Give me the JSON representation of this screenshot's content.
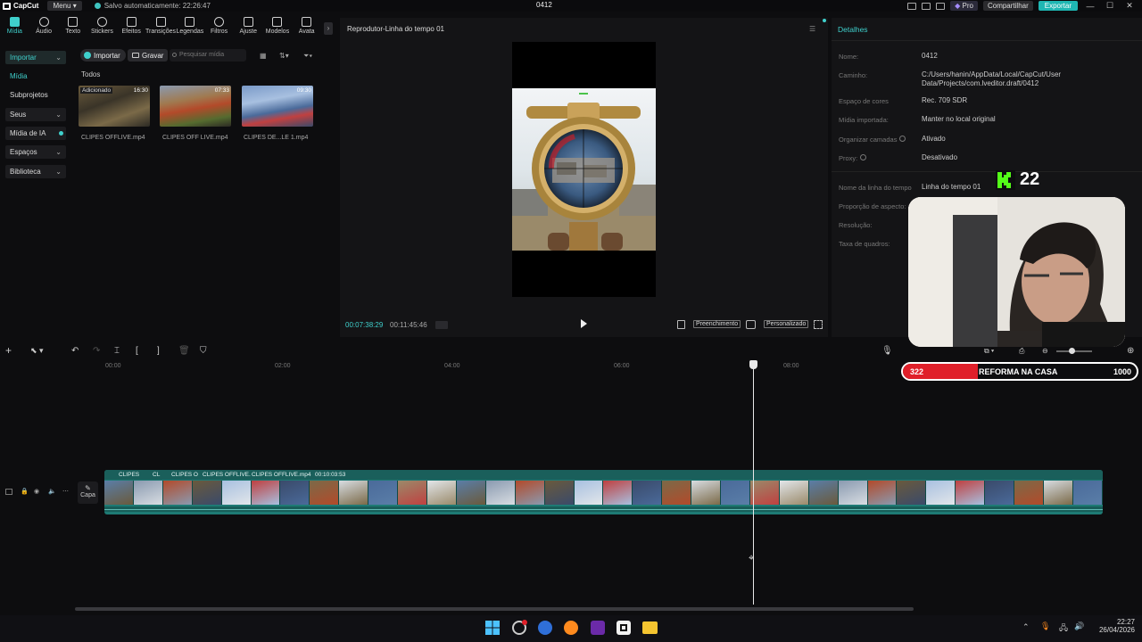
{
  "topbar": {
    "app_name": "CapCut",
    "menu_label": "Menu",
    "autosave": "Salvo automaticamente: 22:26:47",
    "project_title": "0412",
    "pro_label": "Pro",
    "share_label": "Compartilhar",
    "export_label": "Exportar"
  },
  "toolbar": {
    "items": [
      "Mídia",
      "Áudio",
      "Texto",
      "Stickers",
      "Efeitos",
      "Transições",
      "Legendas",
      "Filtros",
      "Ajuste",
      "Modelos",
      "Avata"
    ]
  },
  "leftnav": {
    "items": [
      "Importar",
      "Mídia",
      "Subprojetos",
      "Seus",
      "Mídia de IA",
      "Espaços",
      "Biblioteca"
    ]
  },
  "media": {
    "import_label": "Importar",
    "record_label": "Gravar",
    "search_placeholder": "Pesquisar mídia",
    "filter_all": "Todos",
    "clips": [
      {
        "name": "CLIPES OFFLIVE.mp4",
        "badge": "Adicionado",
        "duration": "16:30"
      },
      {
        "name": "CLIPES OFF LIVE.mp4",
        "badge": "",
        "duration": "07:33"
      },
      {
        "name": "CLIPES DE...LE 1.mp4",
        "badge": "",
        "duration": "09:30"
      }
    ]
  },
  "player": {
    "title": "Reprodutor-Linha do tempo 01",
    "current_time": "00:07:38:29",
    "total_time": "00:11:45:46",
    "fill_label": "Preenchimento",
    "custom_label": "Personalizado"
  },
  "details": {
    "title": "Detalhes",
    "rows": [
      {
        "label": "Nome:",
        "value": "0412"
      },
      {
        "label": "Caminho:",
        "value": "C:/Users/hanin/AppData/Local/CapCut/User Data/Projects/com.lveditor.draft/0412"
      },
      {
        "label": "Espaço de cores",
        "value": "Rec. 709 SDR"
      },
      {
        "label": "Mídia importada:",
        "value": "Manter no local original"
      },
      {
        "label": "Organizar camadas",
        "value": "Ativado"
      },
      {
        "label": "Proxy:",
        "value": "Desativado"
      },
      {
        "label": "Nome da linha do tempo",
        "value": "Linha do tempo 01"
      },
      {
        "label": "Proporção de aspecto:",
        "value": ""
      },
      {
        "label": "Resolução:",
        "value": ""
      },
      {
        "label": "Taxa de quadros:",
        "value": ""
      }
    ]
  },
  "overlay": {
    "kick_count": "22",
    "goal_current": "322",
    "goal_title": "REFORMA NA CASA",
    "goal_target": "1000",
    "goal_progress": 0.322
  },
  "timeline": {
    "ruler": [
      "00:00",
      "02:00",
      "04:00",
      "06:00",
      "08:00"
    ],
    "track_labels": [
      "CLIPES",
      "CL",
      "CLIPES O",
      "CLIPES OFFLIVE.",
      "CLIPES OFFLIVE.mp4",
      "00:10:03:53"
    ],
    "cover_label": "Capa"
  },
  "taskbar": {
    "time": "22:27",
    "date": "26/04/2026"
  },
  "colors": {
    "accent": "#1fb7b3",
    "track": "#1e7a74",
    "goal_red": "#e0202a"
  }
}
